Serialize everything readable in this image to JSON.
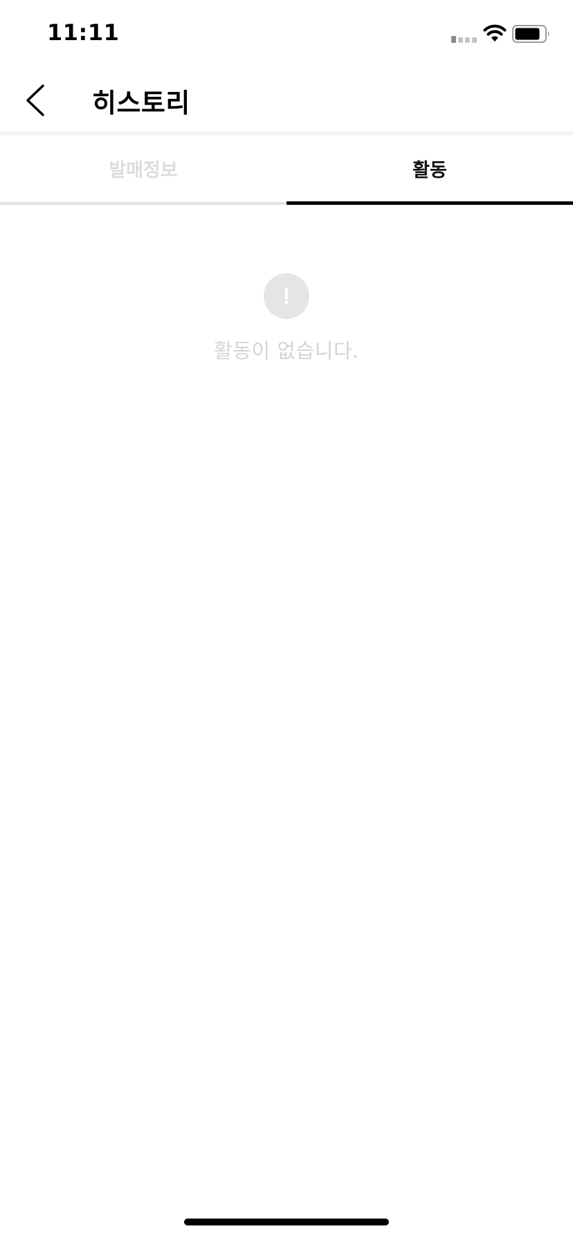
{
  "status_bar": {
    "time": "11:11",
    "icons": [
      "signal-icon",
      "wifi-icon",
      "battery-icon"
    ]
  },
  "header": {
    "back_icon": "chevron-left-icon",
    "title": "히스토리"
  },
  "tabs": [
    {
      "label": "발매정보",
      "active": false
    },
    {
      "label": "활동",
      "active": true
    }
  ],
  "empty_state": {
    "icon": "exclamation-circle-icon",
    "icon_glyph": "!",
    "message": "활동이 없습니다."
  },
  "colors": {
    "background": "#ffffff",
    "active_tab_text": "#111111",
    "inactive_tab_text": "#dcdcdc",
    "active_underline": "#000000",
    "inactive_underline": "#e3e3e3",
    "empty_text": "#d4d4d4",
    "empty_icon_bg": "#e5e5e5"
  }
}
